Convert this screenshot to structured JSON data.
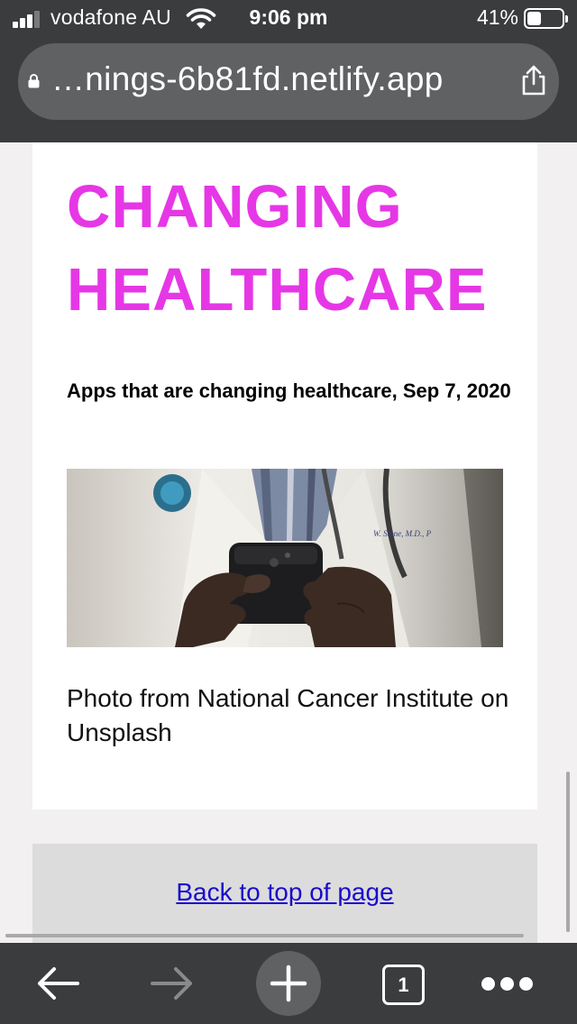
{
  "status_bar": {
    "carrier": "vodafone AU",
    "time": "9:06 pm",
    "battery_percent": "41%",
    "battery_level": 0.41,
    "signal_bars": 3,
    "signal_bars_total": 4
  },
  "address_bar": {
    "url": "…nings-6b81fd.netlify.app",
    "secure_icon": "lock-icon",
    "share_icon": "share-icon"
  },
  "article": {
    "headline": "CHANGING HEALTHCARE",
    "headline_color": "#e637e6",
    "subhead": "Apps that are changing healthcare, Sep 7, 2020",
    "image_description_icon": "doctor-holding-phone-photo",
    "caption": "Photo from National Cancer Institute on Unsplash"
  },
  "footer": {
    "back_to_top": "Back to top of page",
    "link_color": "#1a0dcc"
  },
  "toolbar": {
    "back_icon": "arrow-left-icon",
    "forward_icon": "arrow-right-icon",
    "new_tab_icon": "plus-icon",
    "tab_count": "1",
    "menu_icon": "more-dots-icon"
  }
}
